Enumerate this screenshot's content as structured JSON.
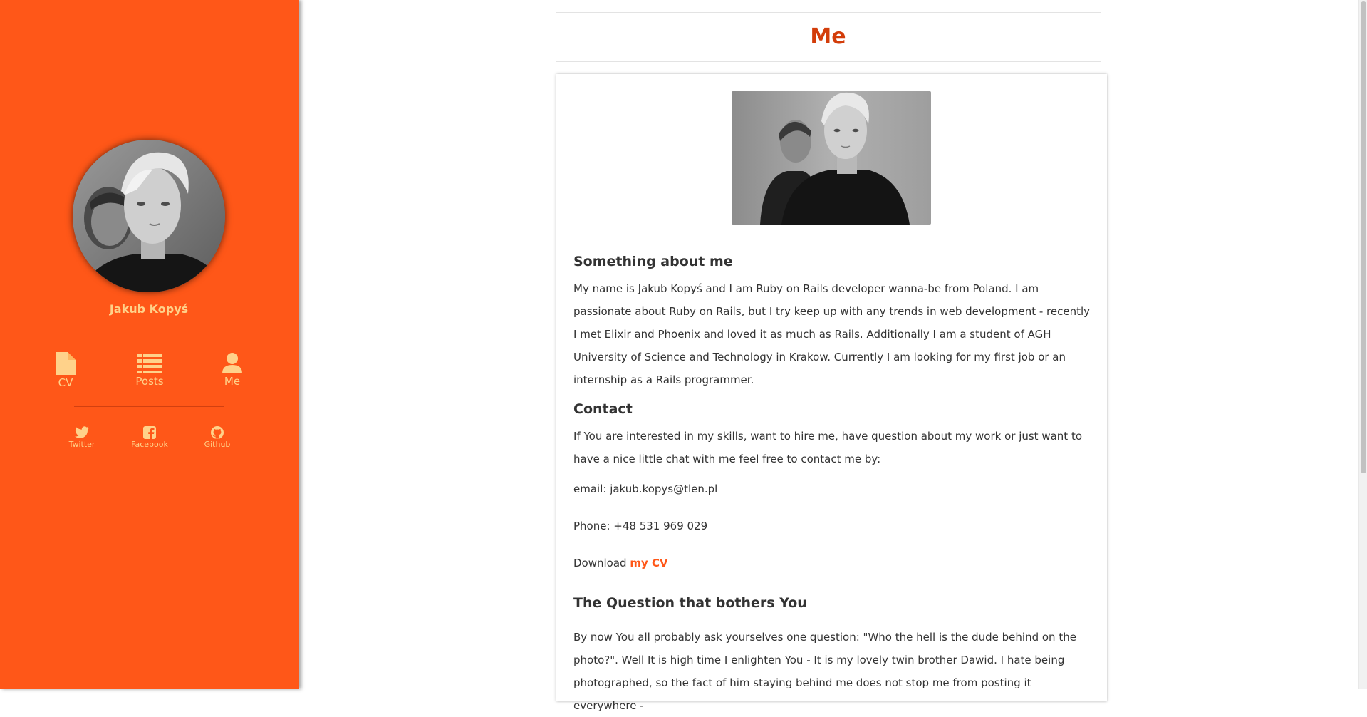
{
  "sidebar": {
    "author_name": "Jakub Kopyś",
    "nav": [
      {
        "label": "CV",
        "icon": "file-icon"
      },
      {
        "label": "Posts",
        "icon": "list-icon"
      },
      {
        "label": "Me",
        "icon": "user-icon"
      }
    ],
    "social": [
      {
        "label": "Twitter",
        "icon": "twitter-icon"
      },
      {
        "label": "Facebook",
        "icon": "facebook-icon"
      },
      {
        "label": "Github",
        "icon": "github-icon"
      }
    ]
  },
  "page": {
    "title": "Me"
  },
  "sections": {
    "about": {
      "heading": "Something about me",
      "text": "My name is Jakub Kopyś and I am Ruby on Rails developer wanna-be from Poland. I am passionate about Ruby on Rails, but I try keep up with any trends in web development - recently I met Elixir and Phoenix and loved it as much as Rails. Additionally I am a student of AGH University of Science and Technology in Krakow. Currently I am looking for my first job or an internship as a Rails programmer."
    },
    "contact": {
      "heading": "Contact",
      "text": "If You are interested in my skills, want to hire me, have question about my work or just want to have a nice little chat with me feel free to contact me by:",
      "email": "email: jakub.kopys@tlen.pl",
      "phone": "Phone: +48 531 969 029",
      "download_prefix": "Download ",
      "cv_link": "my CV"
    },
    "question": {
      "heading": "The Question that bothers You",
      "text": "By now You all probably ask yourselves one question: \"Who the hell is the dude behind on the photo?\". Well It is high time I enlighten You - It is my lovely twin brother Dawid. I hate being photographed, so the fact of him staying behind me does not stop me from posting it everywhere -"
    }
  },
  "colors": {
    "sidebar": "#ff5718",
    "accent": "#d33d0a",
    "sidebar_text": "#ffd28a",
    "link": "#ff5718"
  }
}
